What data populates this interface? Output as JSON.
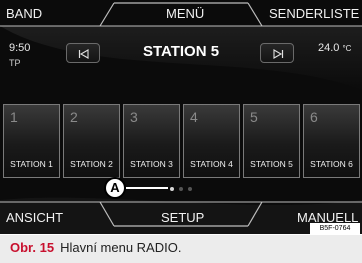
{
  "top_bar": {
    "band_label": "BAND",
    "menu_label": "MENÜ",
    "senderliste_label": "SENDERLISTE"
  },
  "status": {
    "time": "9:50",
    "tp": "TP",
    "temperature": "24.0",
    "temperature_unit": "°C"
  },
  "station": {
    "current": "STATION 5"
  },
  "seek": {
    "prev_icon": "skip-previous-icon",
    "next_icon": "skip-next-icon"
  },
  "presets": [
    {
      "number": "1",
      "name": "STATION 1"
    },
    {
      "number": "2",
      "name": "STATION 2"
    },
    {
      "number": "3",
      "name": "STATION 3"
    },
    {
      "number": "4",
      "name": "STATION 4"
    },
    {
      "number": "5",
      "name": "STATION 5"
    },
    {
      "number": "6",
      "name": "STATION 6"
    }
  ],
  "pagination": {
    "pages": 3,
    "active": 1
  },
  "callout": {
    "letter": "A"
  },
  "bottom_bar": {
    "ansicht_label": "ANSICHT",
    "setup_label": "SETUP",
    "manuell_label": "MANUELL"
  },
  "image_code": "B5F-0764",
  "caption": {
    "label": "Obr. 15",
    "text": "Hlavní menu RADIO."
  },
  "colors": {
    "background": "#0b0b0b",
    "text": "#f2f2f2",
    "caption_accent": "#c8102e"
  }
}
